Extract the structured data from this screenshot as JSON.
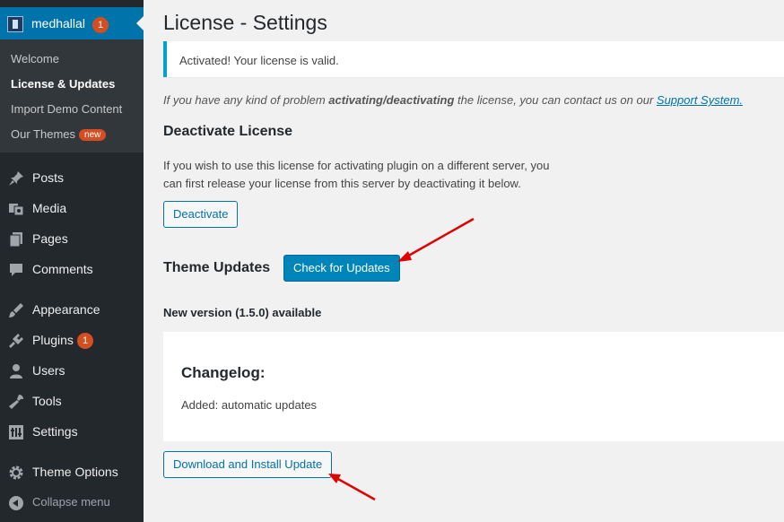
{
  "sidebar": {
    "site_name": "medhallal",
    "site_badge": "1",
    "submenu": [
      {
        "label": "Welcome"
      },
      {
        "label": "License & Updates"
      },
      {
        "label": "Import Demo Content"
      },
      {
        "label": "Our Themes",
        "badge": "new"
      }
    ],
    "menu": [
      {
        "label": "Posts",
        "icon": "pushpin-icon"
      },
      {
        "label": "Media",
        "icon": "media-icon"
      },
      {
        "label": "Pages",
        "icon": "pages-icon"
      },
      {
        "label": "Comments",
        "icon": "comments-icon"
      },
      {
        "label": "Appearance",
        "icon": "paintbrush-icon"
      },
      {
        "label": "Plugins",
        "icon": "plugins-icon",
        "badge": "1"
      },
      {
        "label": "Users",
        "icon": "users-icon"
      },
      {
        "label": "Tools",
        "icon": "tools-icon"
      },
      {
        "label": "Settings",
        "icon": "settings-icon"
      },
      {
        "label": "Theme Options",
        "icon": "gear-icon"
      }
    ],
    "collapse_label": "Collapse menu"
  },
  "main": {
    "title": "License - Settings",
    "notice": "Activated! Your license is valid.",
    "help_text_prefix": "If you have any kind of problem ",
    "help_text_bold": "activating/deactivating",
    "help_text_suffix": " the license, you can contact us on our ",
    "support_link": "Support System.",
    "deactivate_heading": "Deactivate License",
    "deactivate_desc_line1": "If you wish to use this license for activating plugin on a different server, you",
    "deactivate_desc_line2": "can first release your license from this server by deactivating it below.",
    "deactivate_button": "Deactivate",
    "updates_heading": "Theme Updates",
    "check_updates_button": "Check for Updates",
    "new_version": "New version (1.5.0) available",
    "changelog_title": "Changelog:",
    "changelog_entry": "Added: automatic updates",
    "install_button": "Download and Install Update"
  },
  "colors": {
    "sidebar_bg": "#23282d",
    "active_bg": "#0073aa",
    "badge": "#d54e21",
    "primary_button": "#0085ba",
    "annotation_arrow": "#e00000"
  }
}
